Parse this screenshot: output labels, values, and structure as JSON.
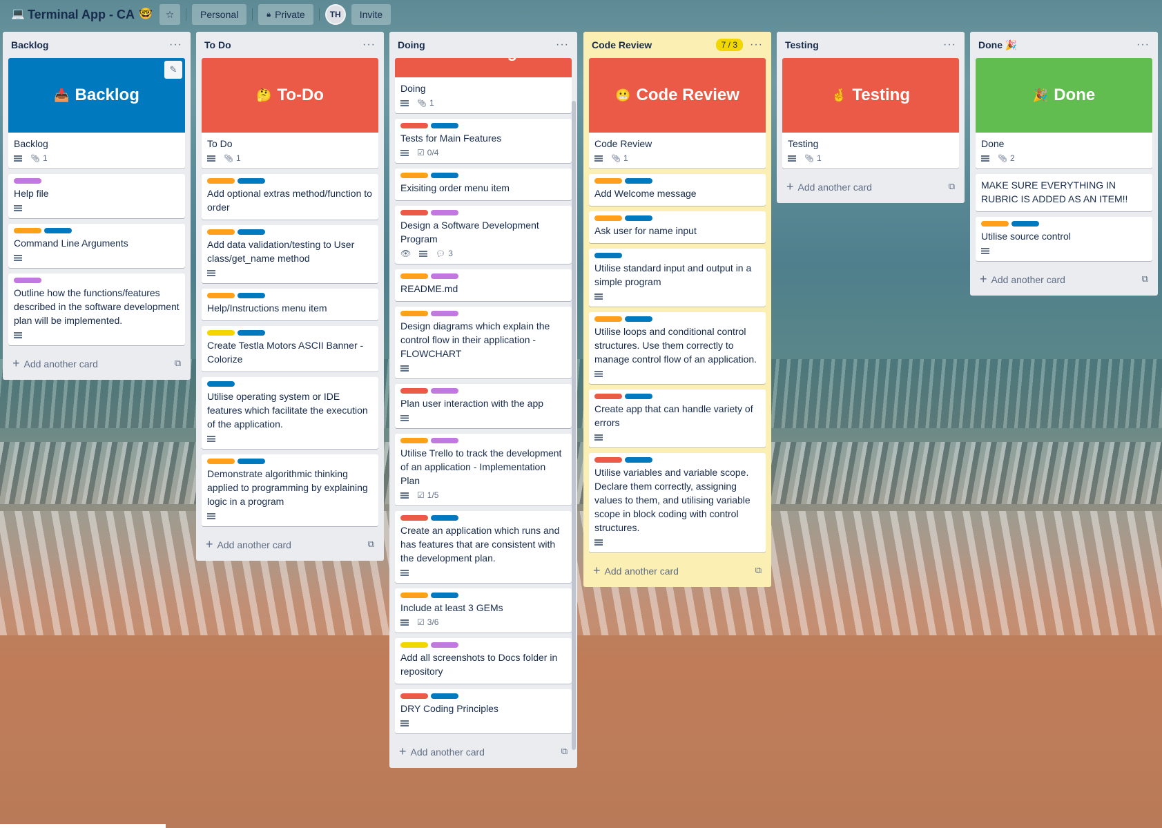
{
  "board": {
    "icon": "💻",
    "title": "Terminal App - CA",
    "title_emoji": "🤓",
    "visibility_team": "Personal",
    "visibility": "Private",
    "member_initials": "TH",
    "invite_label": "Invite"
  },
  "colors": {
    "red": "#eb5a46",
    "blue": "#0079bf",
    "orange": "#ff9f1a",
    "purple": "#c377e0",
    "yellow": "#f2d600",
    "green": "#61bd4f"
  },
  "add_card_label": "Add another card",
  "lists": [
    {
      "title": "Backlog",
      "cover": {
        "emoji": "📥",
        "text": "Backlog",
        "color": "#0079bf"
      },
      "cover_card": {
        "title": "Backlog",
        "attachments": "1"
      },
      "cards": [
        {
          "labels": [
            "purple"
          ],
          "title": "Help file",
          "desc": true
        },
        {
          "labels": [
            "orange",
            "blue"
          ],
          "title": "Command Line Arguments",
          "desc": true
        },
        {
          "labels": [
            "purple"
          ],
          "title": "Outline how the functions/features described in the software development plan will be implemented.",
          "desc": true
        }
      ]
    },
    {
      "title": "To Do",
      "cover": {
        "emoji": "🤔",
        "text": "To-Do",
        "color": "#eb5a46"
      },
      "cover_card": {
        "title": "To Do",
        "attachments": "1"
      },
      "cards": [
        {
          "labels": [
            "orange",
            "blue"
          ],
          "title": "Add optional extras method/function to order",
          "desc": false
        },
        {
          "labels": [
            "orange",
            "blue"
          ],
          "title": "Add data validation/testing to User class/get_name method",
          "desc": true
        },
        {
          "labels": [
            "orange",
            "blue"
          ],
          "title": "Help/Instructions menu item",
          "desc": false
        },
        {
          "labels": [
            "yellow",
            "blue"
          ],
          "title": "Create Testla Motors ASCII Banner - Colorize",
          "desc": false
        },
        {
          "labels": [
            "blue"
          ],
          "title": "Utilise operating system or IDE features which facilitate the execution of the application.",
          "desc": true
        },
        {
          "labels": [
            "orange",
            "blue"
          ],
          "title": "Demonstrate algorithmic thinking applied to programming by explaining logic in a program",
          "desc": true
        }
      ]
    },
    {
      "title": "Doing",
      "cover": {
        "emoji": "😬",
        "text": "Doing",
        "color": "#eb5a46"
      },
      "cover_card": {
        "title": "Doing",
        "attachments": "1"
      },
      "cards": [
        {
          "labels": [
            "red",
            "blue"
          ],
          "title": "Tests for Main Features",
          "desc": true,
          "checklist": "0/4"
        },
        {
          "labels": [
            "orange",
            "blue"
          ],
          "title": "Exisiting order menu item",
          "desc": false
        },
        {
          "labels": [
            "red",
            "purple"
          ],
          "title": "Design a Software Development Program",
          "desc": true,
          "watch": true,
          "comments": "3"
        },
        {
          "labels": [
            "orange",
            "purple"
          ],
          "title": "README.md",
          "desc": false
        },
        {
          "labels": [
            "orange",
            "purple"
          ],
          "title": "Design diagrams which explain the control flow in their application - FLOWCHART",
          "desc": true
        },
        {
          "labels": [
            "red",
            "purple"
          ],
          "title": "Plan user interaction with the app",
          "desc": true
        },
        {
          "labels": [
            "orange",
            "purple"
          ],
          "title": "Utilise Trello to track the development of an application - Implementation Plan",
          "desc": true,
          "checklist": "1/5"
        },
        {
          "labels": [
            "red",
            "blue"
          ],
          "title": "Create an application which runs and has features that are consistent with the development plan.",
          "desc": true
        },
        {
          "labels": [
            "orange",
            "blue"
          ],
          "title": "Include at least 3 GEMs",
          "desc": true,
          "checklist": "3/6"
        },
        {
          "labels": [
            "yellow",
            "purple"
          ],
          "title": "Add all screenshots to Docs folder in repository",
          "desc": false
        },
        {
          "labels": [
            "red",
            "blue"
          ],
          "title": "DRY Coding Principles",
          "desc": true
        }
      ]
    },
    {
      "title": "Code Review",
      "wip": "7 / 3",
      "cover": {
        "emoji": "😬",
        "text": "Code Review",
        "color": "#eb5a46"
      },
      "cover_card": {
        "title": "Code Review",
        "attachments": "1"
      },
      "cards": [
        {
          "labels": [
            "orange",
            "blue"
          ],
          "title": "Add Welcome message",
          "desc": false
        },
        {
          "labels": [
            "orange",
            "blue"
          ],
          "title": "Ask user for name input",
          "desc": false
        },
        {
          "labels": [
            "blue"
          ],
          "title": "Utilise standard input and output in a simple program",
          "desc": true
        },
        {
          "labels": [
            "orange",
            "blue"
          ],
          "title": "Utilise loops and conditional control structures. Use them correctly to manage control flow of an application.",
          "desc": true
        },
        {
          "labels": [
            "red",
            "blue"
          ],
          "title": "Create app that can handle variety of errors",
          "desc": true
        },
        {
          "labels": [
            "red",
            "blue"
          ],
          "title": "Utilise variables and variable scope. Declare them correctly, assigning values to them, and utilising variable scope in block coding with control structures.",
          "desc": true
        }
      ]
    },
    {
      "title": "Testing",
      "cover": {
        "emoji": "🤞",
        "text": "Testing",
        "color": "#eb5a46"
      },
      "cover_card": {
        "title": "Testing",
        "attachments": "1"
      },
      "cards": []
    },
    {
      "title": "Done 🎉",
      "cover": {
        "emoji": "🎉",
        "text": "Done",
        "color": "#61bd4f"
      },
      "cover_card": {
        "title": "Done",
        "attachments": "2"
      },
      "cards": [
        {
          "labels": [],
          "title": "MAKE SURE EVERYTHING IN RUBRIC IS ADDED AS AN ITEM!!",
          "desc": false
        },
        {
          "labels": [
            "orange",
            "blue"
          ],
          "title": "Utilise source control",
          "desc": true
        }
      ]
    }
  ]
}
